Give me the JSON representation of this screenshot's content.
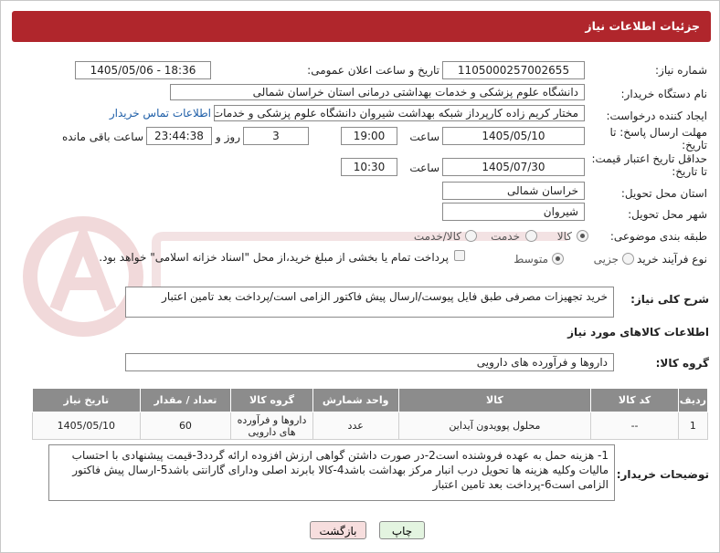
{
  "header": {
    "title": "جزئیات اطلاعات نیاز"
  },
  "form": {
    "need_number_label": "شماره نیاز:",
    "need_number": "1105000257002655",
    "announce_label": "تاریخ و ساعت اعلان عمومی:",
    "announce_value": "1405/05/06 - 18:36",
    "buyer_org_label": "نام دستگاه خریدار:",
    "buyer_org": "دانشگاه علوم پزشکی و خدمات بهداشتی درمانی استان خراسان شمالی",
    "requester_label": "ایجاد کننده درخواست:",
    "requester": "مختار کریم زاده کارپرداز شبکه بهداشت شیروان دانشگاه علوم پزشکی و خدمات",
    "contact_link": "اطلاعات تماس خریدار",
    "deadline_label_1": "مهلت ارسال پاسخ: تا",
    "deadline_label_2": "تاریخ:",
    "deadline_date": "1405/05/10",
    "hour_label": "ساعت",
    "deadline_time": "19:00",
    "days_value": "3",
    "days_label": "روز و",
    "remaining_time": "23:44:38",
    "remaining_label": "ساعت باقی مانده",
    "validity_label_1": "حداقل تاریخ اعتبار قیمت:",
    "validity_label_2": "تا تاریخ:",
    "validity_date": "1405/07/30",
    "validity_time": "10:30",
    "province_label": "استان محل تحویل:",
    "province": "خراسان شمالی",
    "city_label": "شهر محل تحویل:",
    "city": "شیروان",
    "category_label": "طبقه بندی موضوعی:",
    "category_options": [
      "کالا",
      "خدمت",
      "کالا/خدمت"
    ],
    "process_label": "نوع فرآیند خرید :",
    "process_options": [
      "جزیی",
      "متوسط"
    ],
    "payment_note": "پرداخت تمام یا بخشی از مبلغ خرید،از محل \"اسناد خزانه اسلامی\" خواهد بود.",
    "general_desc_label": "شرح کلی نیاز:",
    "general_desc": "خرید تجهیزات مصرفی طبق فایل پیوست/ارسال پیش فاکتور الزامی است/پرداخت بعد تامین اعتبار",
    "goods_info_title": "اطلاعات کالاهای مورد نیاز",
    "goods_group_label": "گروه کالا:",
    "goods_group": "داروها و فرآورده های دارویی",
    "buyer_notes_label": "توضیحات خریدار:",
    "buyer_notes": "1- هزینه حمل به عهده فروشنده است2-در صورت داشتن گواهی ارزش افزوده ارائه گردد3-قیمت پیشنهادی با احتساب مالیات وکلیه هزینه ها تحویل درب انبار مرکز بهداشت باشد4-کالا بابرند اصلی ودارای گارانتی باشد5-ارسال پیش فاکتور الزامی است6-پرداخت بعد تامین اعتبار"
  },
  "table": {
    "headers": [
      "ردیف",
      "کد کالا",
      "کالا",
      "واحد شمارش",
      "گروه کالا",
      "تعداد / مقدار",
      "تاریخ نیاز"
    ],
    "rows": [
      [
        "1",
        "--",
        "محلول پوویدون آیداین",
        "عدد",
        "داروها و فرآورده های دارویی",
        "60",
        "1405/05/10"
      ]
    ]
  },
  "buttons": {
    "print": "چاپ",
    "back": "بازگشت"
  },
  "colors": {
    "header_bg": "#b0262c",
    "table_header_bg": "#8c8c8c",
    "back_button_bg": "#f7dede",
    "print_button_bg": "#e3f4e0",
    "link": "#1f5fa8"
  }
}
